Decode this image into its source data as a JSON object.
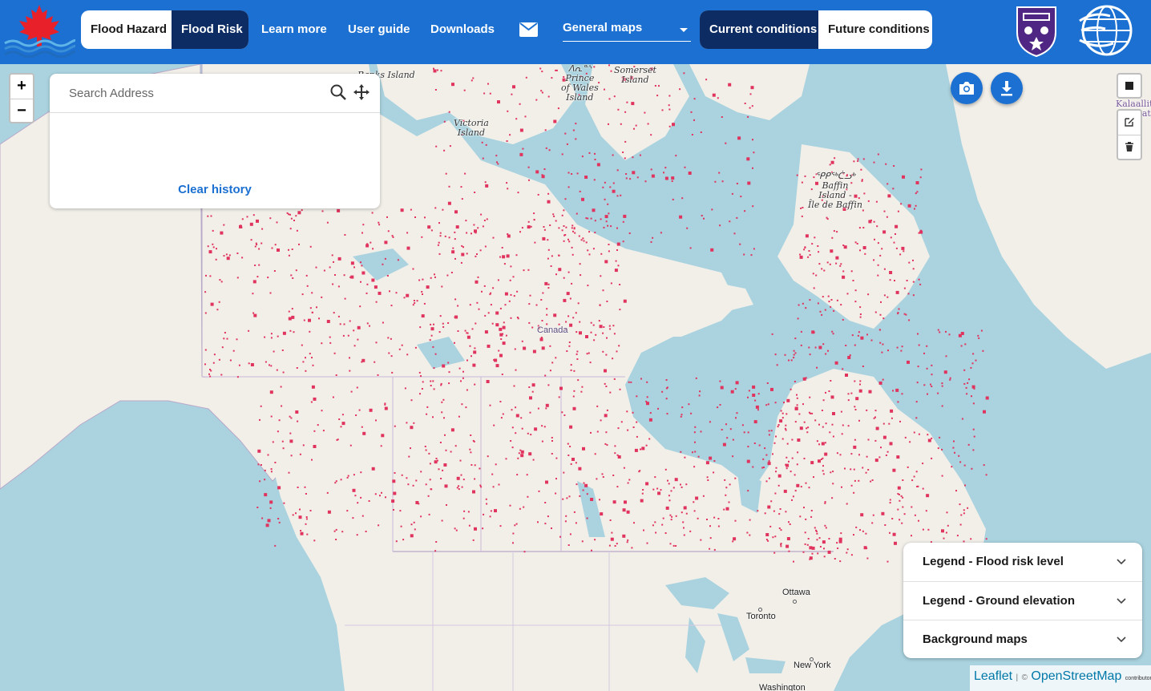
{
  "header": {
    "hazard_tabs": [
      {
        "label": "Flood Hazard",
        "active": false
      },
      {
        "label": "Flood Risk",
        "active": true
      }
    ],
    "links": [
      "Learn more",
      "User guide",
      "Downloads"
    ],
    "map_type_select": "General maps",
    "condition_tabs": [
      {
        "label": "Current conditions",
        "active": true
      },
      {
        "label": "Future conditions",
        "active": false
      }
    ],
    "colors": {
      "bar": "#1b70d1",
      "active_tab": "#0c2c63",
      "flood_risk": "#e0345e"
    }
  },
  "zoom": {
    "in": "+",
    "out": "−"
  },
  "search": {
    "placeholder": "Search Address",
    "value": "",
    "clear_history": "Clear history"
  },
  "icons": {
    "logo": "maple-leaf-waves-logo",
    "mail": "mail-icon",
    "camera": "camera-icon",
    "download": "download-icon",
    "draw": "draw-rectangle-icon",
    "edit": "edit-icon",
    "delete": "trash-icon",
    "university": "university-shield-logo",
    "globe": "globe-logo"
  },
  "map": {
    "labels": {
      "victoria": "Victoria\nIsland",
      "baffin": "ᕿᑭᖅᑖᓗᒃ\nBaffin\nIsland -\nÎle de Baffin",
      "somerset": "Somerset\nIsland",
      "prince_of_wales": "ᐱᕆᓐᔅ\nPrince\nof Wales\nIsland",
      "banks": "Banks Island",
      "canada": "Canada",
      "kalaallit": "Kalaallit\nNunaat",
      "ottawa": "Ottawa",
      "toronto": "Toronto",
      "new_york": "New York",
      "washington": "Washington"
    }
  },
  "legend": {
    "rows": [
      "Legend - Flood risk level",
      "Legend - Ground elevation",
      "Background maps"
    ]
  },
  "attribution": {
    "leaflet": "Leaflet",
    "separator": "|",
    "copyright": "©",
    "osm": "OpenStreetMap",
    "suffix": "contributors"
  }
}
